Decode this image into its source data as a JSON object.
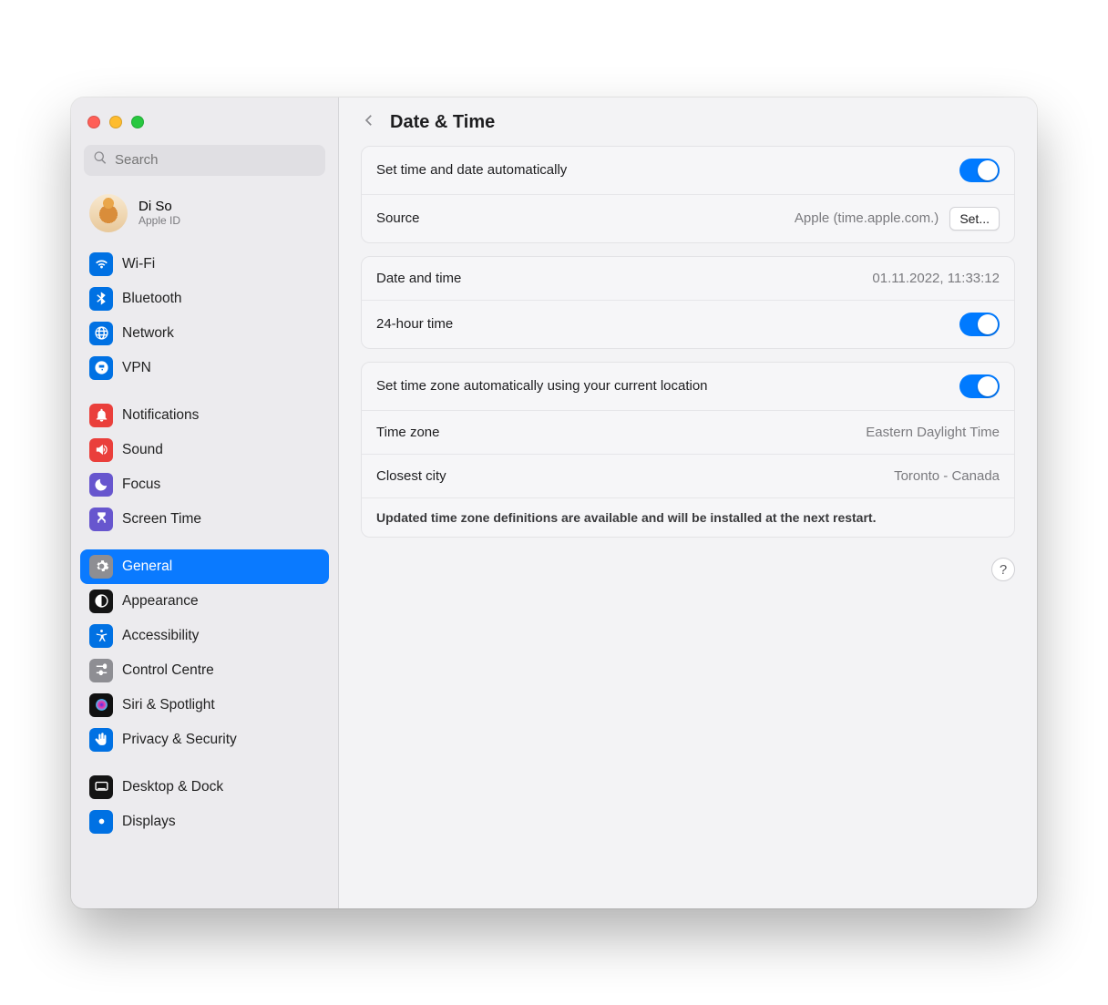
{
  "window": {
    "title": "Date & Time"
  },
  "search": {
    "placeholder": "Search"
  },
  "account": {
    "name": "Di So",
    "sub": "Apple ID"
  },
  "sidebar": {
    "group1": [
      {
        "label": "Wi-Fi",
        "icon": "wifi",
        "bg": "#0071e3"
      },
      {
        "label": "Bluetooth",
        "icon": "bluetooth",
        "bg": "#0071e3"
      },
      {
        "label": "Network",
        "icon": "globe",
        "bg": "#0071e3"
      },
      {
        "label": "VPN",
        "icon": "vpn",
        "bg": "#0071e3"
      }
    ],
    "group2": [
      {
        "label": "Notifications",
        "icon": "bell",
        "bg": "#ea3f3b"
      },
      {
        "label": "Sound",
        "icon": "speaker",
        "bg": "#ea3f3b"
      },
      {
        "label": "Focus",
        "icon": "moon",
        "bg": "#6756ce"
      },
      {
        "label": "Screen Time",
        "icon": "hourglass",
        "bg": "#6756ce"
      }
    ],
    "group3": [
      {
        "label": "General",
        "icon": "gear",
        "bg": "#8e8e93",
        "selected": true
      },
      {
        "label": "Appearance",
        "icon": "appearance",
        "bg": "#141414"
      },
      {
        "label": "Accessibility",
        "icon": "accessibility",
        "bg": "#0071e3"
      },
      {
        "label": "Control Centre",
        "icon": "controls",
        "bg": "#8e8e93"
      },
      {
        "label": "Siri & Spotlight",
        "icon": "siri",
        "bg": "#111"
      },
      {
        "label": "Privacy & Security",
        "icon": "hand",
        "bg": "#0071e3"
      }
    ],
    "group4": [
      {
        "label": "Desktop & Dock",
        "icon": "dock",
        "bg": "#141414"
      },
      {
        "label": "Displays",
        "icon": "display",
        "bg": "#0071e3"
      }
    ]
  },
  "settings": {
    "auto_datetime_label": "Set time and date automatically",
    "auto_datetime_on": true,
    "source_label": "Source",
    "source_value": "Apple (time.apple.com.)",
    "set_button": "Set...",
    "datetime_label": "Date and time",
    "datetime_value": "01.11.2022, 11:33:12",
    "hour24_label": "24-hour time",
    "hour24_on": true,
    "auto_tz_label": "Set time zone automatically using your current location",
    "auto_tz_on": true,
    "tz_label": "Time zone",
    "tz_value": "Eastern Daylight Time",
    "city_label": "Closest city",
    "city_value": "Toronto - Canada",
    "notice": "Updated time zone definitions are available and will be installed at the next restart."
  },
  "help": "?"
}
